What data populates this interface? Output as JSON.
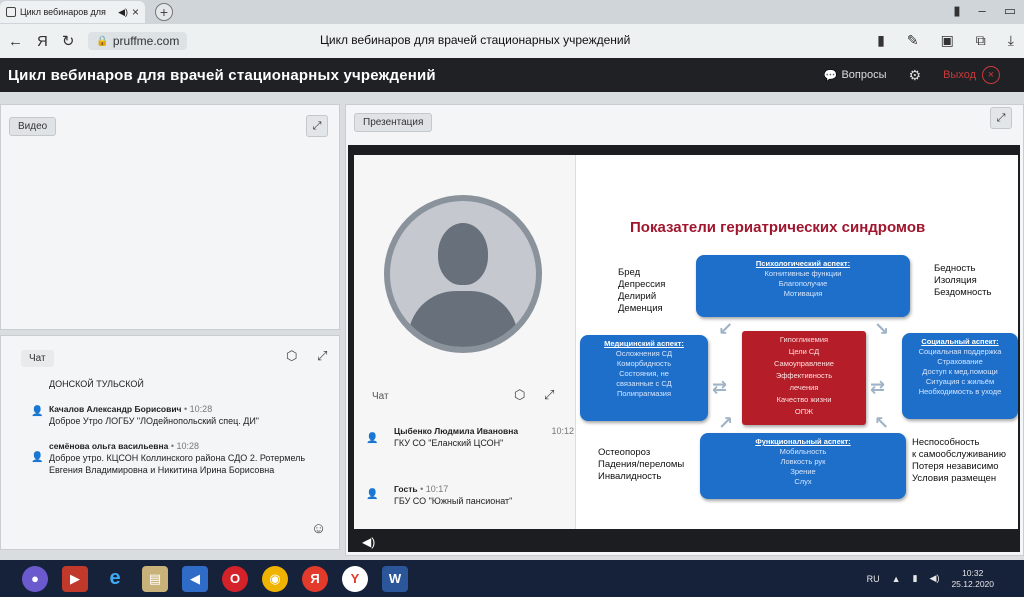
{
  "browser": {
    "tab_title": "Цикл вебинаров для",
    "tab_close": "×",
    "new_tab": "+",
    "url": "pruffme.com",
    "page_title": "Цикл вебинаров для врачей стационарных учреждений",
    "yandex_glyph": "Я"
  },
  "header": {
    "title": "Цикл вебинаров для врачей стационарных учреждений",
    "questions_label": "Вопросы",
    "exit_label": "Выход"
  },
  "video_panel": {
    "label": "Видео"
  },
  "chat_panel": {
    "label": "Чат",
    "first_line": "ДОНСКОЙ ТУЛЬСКОЙ",
    "messages": [
      {
        "author": "Качалов Александр Борисович",
        "time": "10:28",
        "text": "Доброе Утро ЛОГБУ \"ЛОдейнопольский спец. ДИ\""
      },
      {
        "author": "семёнова ольга васильевна",
        "time": "10:28",
        "text": "Доброе утро. КЦСОН Коллинского района СДО 2. Ротермель Евгения Владимировна и Никитина Ирина Борисовна"
      }
    ]
  },
  "presentation_panel": {
    "label": "Презентация",
    "chat_label": "Чат",
    "messages": [
      {
        "author": "Цыбенко Людмила Ивановна",
        "time": "10:12",
        "text": "ГКУ СО \"Еланский ЦСОН\""
      },
      {
        "author": "Гость",
        "time": "10:17",
        "text": "ГБУ СО \"Южный пансионат\""
      }
    ]
  },
  "slide": {
    "title": "Показатели гериатрических синдромов",
    "left_top_list": [
      "Бред",
      "Депрессия",
      "Делирий",
      "Деменция"
    ],
    "right_top_list": [
      "Бедность",
      "Изоляция",
      "Бездомность"
    ],
    "left_bottom_list": [
      "Остеопороз",
      "Падения/переломы",
      "Инвалидность"
    ],
    "right_bottom_list": [
      "Неспособность",
      "к самообслуживанию",
      "Потеря независимо",
      "Условия размещен"
    ],
    "psych": {
      "heading": "Психологический аспект:",
      "items": [
        "Когнитивные функции",
        "Благополучие",
        "Мотивация"
      ]
    },
    "medical": {
      "heading": "Медицинский аспект:",
      "items": [
        "Осложнения СД",
        "Коморбидность",
        "Состояния, не",
        "связанные с СД",
        "Полипрагмазия"
      ]
    },
    "center": {
      "items": [
        "Гипогликемия",
        "Цели СД",
        "Самоуправление",
        "Эффективность",
        "лечения",
        "Качество жизни",
        "ОПЖ"
      ]
    },
    "social": {
      "heading": "Социальный аспект:",
      "items": [
        "Социальная поддержка",
        "Страхование",
        "Доступ к мед.помощи",
        "Ситуация с жильём",
        "Необходимость в уходе"
      ]
    },
    "functional": {
      "heading": "Функциональный аспект:",
      "items": [
        "Мобильность",
        "Ловкость рук",
        "Зрение",
        "Слух"
      ]
    }
  },
  "taskbar": {
    "lang": "RU",
    "time": "10:32",
    "date": "25.12.2020"
  },
  "colors": {
    "header_bg": "#1f2124",
    "slide_title": "#a0162e",
    "blue_box": "#1e6fc9",
    "red_box": "#b51d28"
  }
}
